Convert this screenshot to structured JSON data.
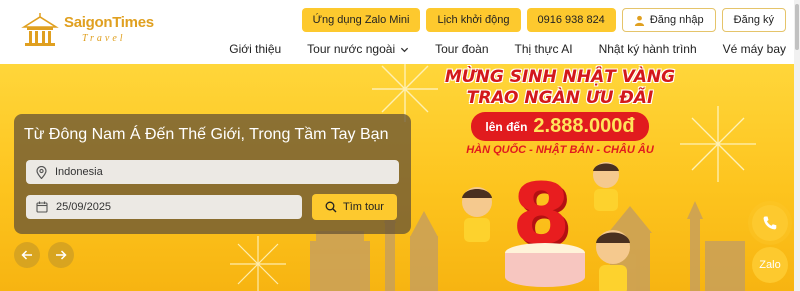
{
  "brand": {
    "name": "SaigonTimes",
    "tagline": "Travel"
  },
  "top_buttons": {
    "zalo_mini": "Ứng dụng Zalo Mini",
    "schedule": "Lịch khởi động",
    "phone": "0916 938 824",
    "login": "Đăng nhập",
    "register": "Đăng ký"
  },
  "nav": {
    "items": [
      "Giới thiệu",
      "Tour nước ngoài",
      "Tour đoàn",
      "Thị thực AI",
      "Nhật ký hành trình",
      "Vé máy bay"
    ]
  },
  "promo": {
    "line1": "MỪNG SINH NHẬT VÀNG",
    "line2": "TRAO NGÀN ƯU ĐÃI",
    "prefix": "lên đến",
    "amount": "2.888.000đ",
    "destinations": "HÀN QUỐC - NHẬT BẢN - CHÂU ÂU",
    "badge_number": "8"
  },
  "search": {
    "title": "Từ Đông Nam Á Đến Thế Giới, Trong Tầm Tay Bạn",
    "destination_value": "Indonesia",
    "date_value": "25/09/2025",
    "button_label": "Tìm tour"
  },
  "floating": {
    "zalo_label": "Zalo"
  },
  "colors": {
    "accent": "#fdc92e",
    "promo_red": "#e11b1e",
    "brand_gold": "#e0a020"
  },
  "icons": [
    "logo-emblem-icon",
    "user-icon",
    "chevron-down-icon",
    "location-pin-icon",
    "calendar-icon",
    "search-icon",
    "arrow-left-icon",
    "arrow-right-icon",
    "phone-icon"
  ]
}
